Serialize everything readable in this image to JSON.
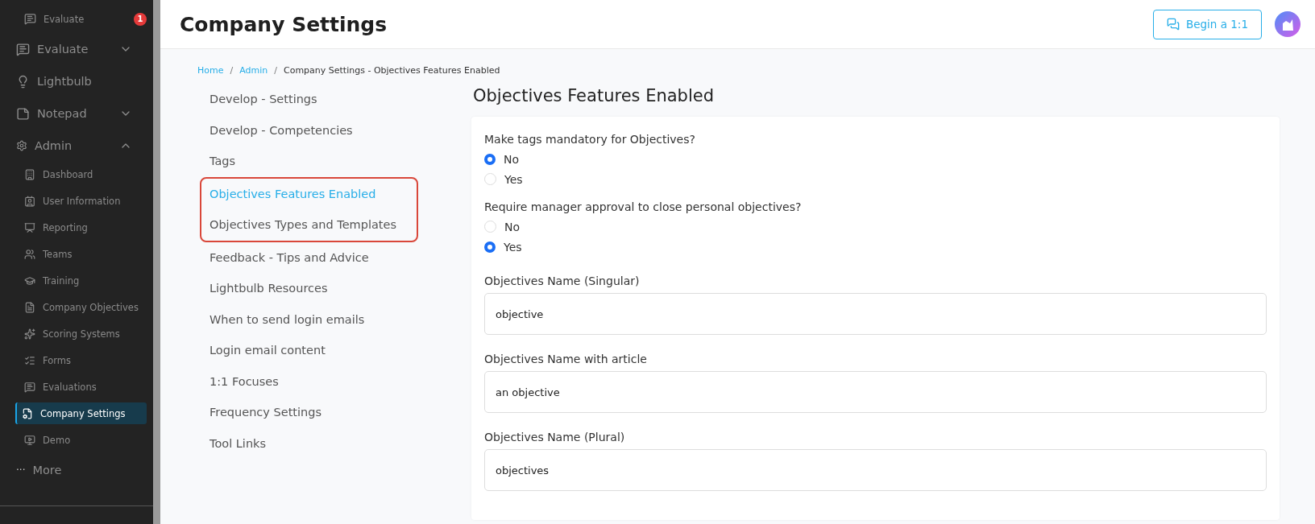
{
  "sidebar": {
    "top_item": {
      "label": "Evaluate",
      "badge": "1"
    },
    "items": [
      {
        "label": "Evaluate",
        "expanded": false
      },
      {
        "label": "Lightbulb"
      },
      {
        "label": "Notepad",
        "expanded": false
      },
      {
        "label": "Admin",
        "expanded": true,
        "children": [
          {
            "label": "Dashboard",
            "selected": false
          },
          {
            "label": "User Information",
            "selected": false
          },
          {
            "label": "Reporting",
            "selected": false
          },
          {
            "label": "Teams",
            "selected": false
          },
          {
            "label": "Training",
            "selected": false
          },
          {
            "label": "Company Objectives",
            "selected": false
          },
          {
            "label": "Scoring Systems",
            "selected": false
          },
          {
            "label": "Forms",
            "selected": false
          },
          {
            "label": "Evaluations",
            "selected": false
          },
          {
            "label": "Company Settings",
            "selected": true
          },
          {
            "label": "Demo",
            "selected": false
          }
        ]
      }
    ],
    "more": {
      "icon": "···",
      "label": "More"
    }
  },
  "header": {
    "title": "Company Settings",
    "button": "Begin a 1:1"
  },
  "breadcrumb_separator": "/",
  "breadcrumb": [
    {
      "label": "Home",
      "link": true
    },
    {
      "label": "Admin",
      "link": true
    },
    {
      "label": "Company Settings - Objectives Features Enabled",
      "link": false
    }
  ],
  "settings_nav": [
    {
      "label": "Develop - Settings",
      "selected": false,
      "highlighted": false
    },
    {
      "label": "Develop - Competencies",
      "selected": false,
      "highlighted": false
    },
    {
      "label": "Tags",
      "selected": false,
      "highlighted": false
    },
    {
      "label": "Objectives Features Enabled",
      "selected": true,
      "highlighted": true
    },
    {
      "label": "Objectives Types and Templates",
      "selected": false,
      "highlighted": true
    },
    {
      "label": "Feedback - Tips and Advice",
      "selected": false,
      "highlighted": false
    },
    {
      "label": "Lightbulb Resources",
      "selected": false,
      "highlighted": false
    },
    {
      "label": "When to send login emails",
      "selected": false,
      "highlighted": false
    },
    {
      "label": "Login email content",
      "selected": false,
      "highlighted": false
    },
    {
      "label": "1:1 Focuses",
      "selected": false,
      "highlighted": false
    },
    {
      "label": "Frequency Settings",
      "selected": false,
      "highlighted": false
    },
    {
      "label": "Tool Links",
      "selected": false,
      "highlighted": false
    }
  ],
  "panel": {
    "title": "Objectives Features Enabled",
    "questions": [
      {
        "label": "Make tags mandatory for Objectives?",
        "options": [
          {
            "label": "No",
            "selected": true
          },
          {
            "label": "Yes",
            "selected": false
          }
        ]
      },
      {
        "label": "Require manager approval to close personal objectives?",
        "options": [
          {
            "label": "No",
            "selected": false
          },
          {
            "label": "Yes",
            "selected": true
          }
        ]
      }
    ],
    "fields": [
      {
        "label": "Objectives Name (Singular)",
        "value": "objective"
      },
      {
        "label": "Objectives Name with article",
        "value": "an objective"
      },
      {
        "label": "Objectives Name (Plural)",
        "value": "objectives"
      }
    ]
  }
}
